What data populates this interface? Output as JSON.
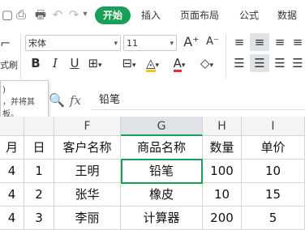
{
  "menu": {
    "tabs": [
      "开始",
      "插入",
      "页面布局",
      "公式",
      "数据"
    ],
    "active_tab": "开始"
  },
  "ribbon": {
    "font_name": "宋体",
    "font_size": "11",
    "format_painter_label": "式刷",
    "bold": "B",
    "italic": "I",
    "underline": "U",
    "font_color_letter": "A",
    "grow_font": "A⁺",
    "shrink_font": "A⁻"
  },
  "tooltip": {
    "lines": [
      ")",
      "，并将其",
      "板。"
    ]
  },
  "formula_bar": {
    "fx": "fx",
    "value": "铅笔"
  },
  "grid": {
    "columns": [
      "F",
      "G",
      "H",
      "I"
    ],
    "selected_column": "G",
    "header_row": [
      "月",
      "日",
      "客户名称",
      "商品名称",
      "数量",
      "单价"
    ],
    "rows": [
      [
        "4",
        "1",
        "王明",
        "铅笔",
        "100",
        "10"
      ],
      [
        "4",
        "2",
        "张华",
        "橡皮",
        "10",
        "15"
      ],
      [
        "4",
        "3",
        "李丽",
        "计算器",
        "200",
        "5"
      ]
    ]
  },
  "colors": {
    "accent": "#18a058",
    "font_color_underline": "#e03030",
    "fill_color_underline": "#f5c518"
  }
}
